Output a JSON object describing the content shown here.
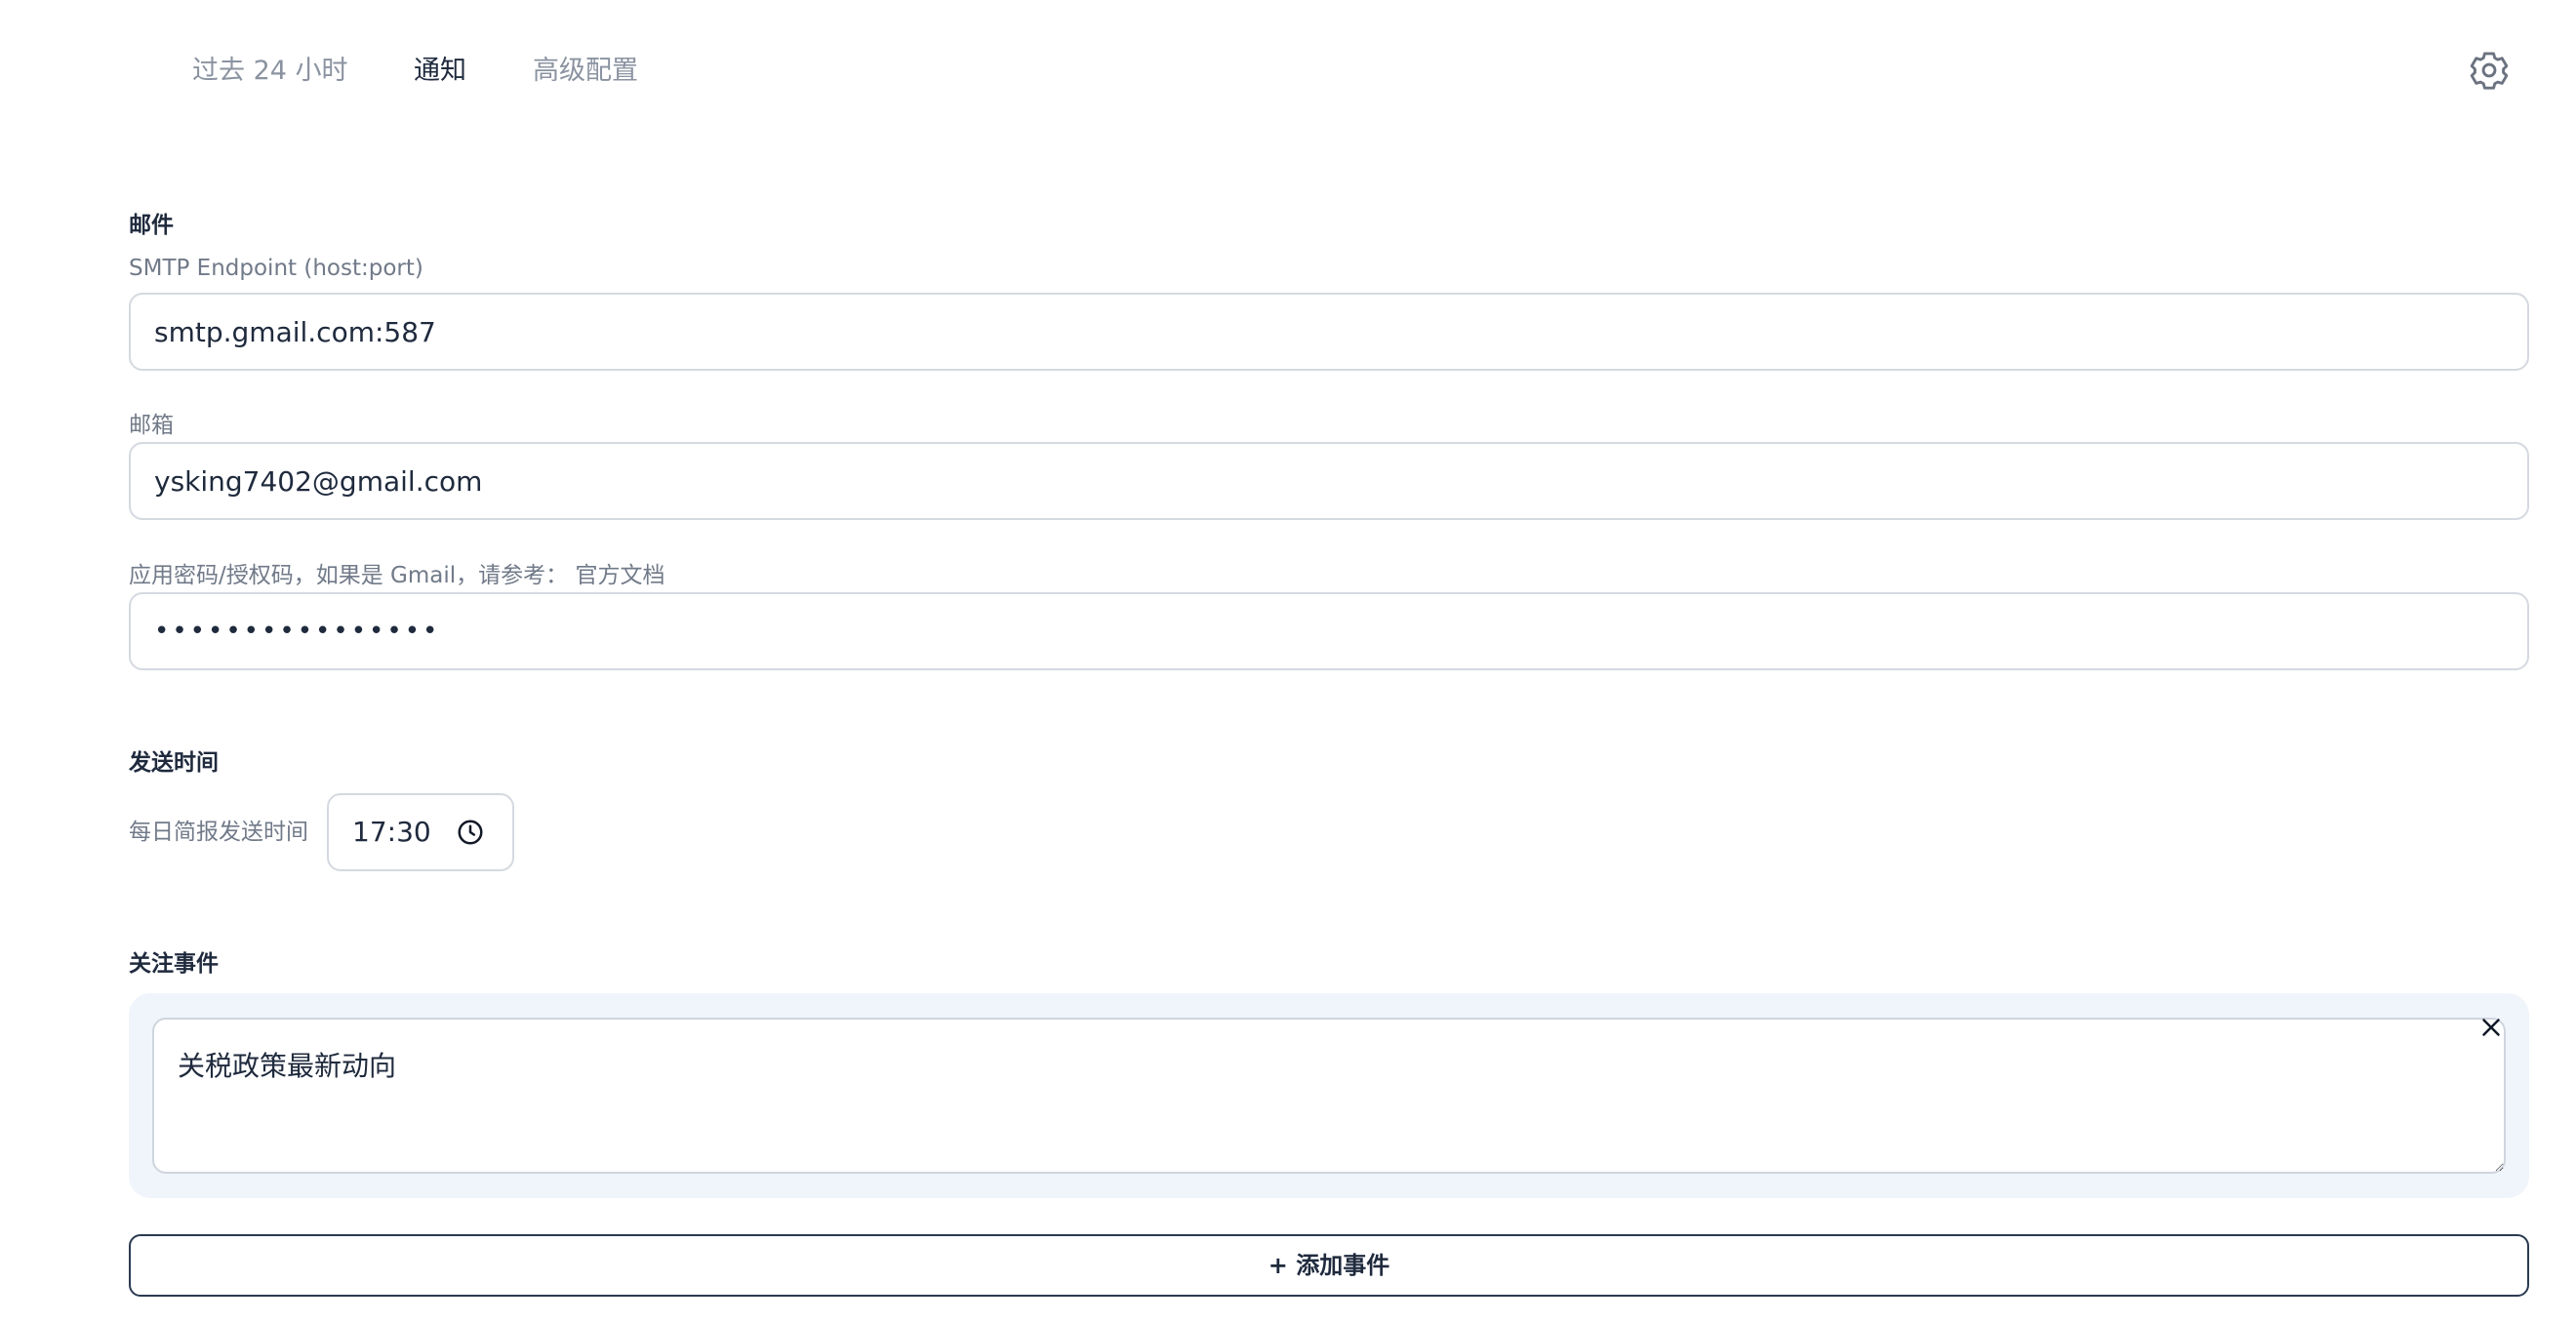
{
  "tabs": [
    {
      "label": "过去 24 小时",
      "active": false
    },
    {
      "label": "通知",
      "active": true
    },
    {
      "label": "高级配置",
      "active": false
    }
  ],
  "settings_icon": "gear-icon",
  "email": {
    "section_title": "邮件",
    "smtp": {
      "label": "SMTP Endpoint (host:port)",
      "value": "smtp.gmail.com:587"
    },
    "mailbox": {
      "label": "邮箱",
      "value": "ysking7402@gmail.com"
    },
    "password": {
      "label": "应用密码/授权码，如果是 Gmail，请参考： 官方文档",
      "value": "••••••••••••••••"
    }
  },
  "schedule": {
    "section_title": "发送时间",
    "label": "每日简报发送时间",
    "time": "17:30",
    "icon": "clock-icon"
  },
  "events": {
    "section_title": "关注事件",
    "items": [
      {
        "text": "关税政策最新动向"
      }
    ],
    "remove_icon": "close-icon",
    "add_label": "+ 添加事件"
  },
  "colors": {
    "text_primary": "#1f2a3d",
    "text_muted": "#8b93a1",
    "card_bg": "#f0f5fb",
    "border": "#d5d9e0",
    "button_border": "#2b3a52"
  }
}
